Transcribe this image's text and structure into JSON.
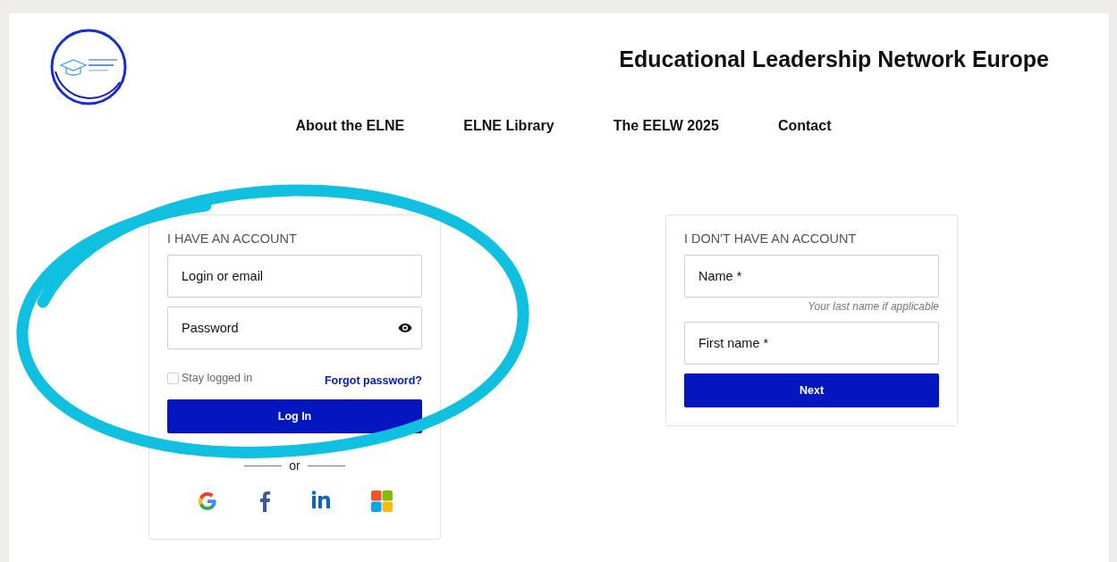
{
  "site_title": "Educational Leadership Network Europe",
  "nav": [
    {
      "label": "About the ELNE"
    },
    {
      "label": "ELNE Library"
    },
    {
      "label": "The EELW 2025"
    },
    {
      "label": "Contact"
    }
  ],
  "login_card": {
    "heading": "I HAVE AN ACCOUNT",
    "fields": [
      {
        "kind": "text",
        "placeholder": "Login or email"
      },
      {
        "kind": "password",
        "placeholder": "Password"
      }
    ],
    "stay_logged_in": {
      "label": "Stay logged in",
      "checked": false
    },
    "forgot_link": "Forgot password?",
    "submit": "Log In",
    "divider": "or",
    "social": [
      {
        "kind": "google"
      },
      {
        "kind": "facebook"
      },
      {
        "kind": "linkedin"
      },
      {
        "kind": "microsoft"
      }
    ]
  },
  "signup_card": {
    "heading": "I DON'T HAVE AN ACCOUNT",
    "fields": [
      {
        "placeholder": "Name *",
        "hint": "Your last name if applicable"
      },
      {
        "placeholder": "First name *"
      }
    ],
    "submit": "Next"
  }
}
